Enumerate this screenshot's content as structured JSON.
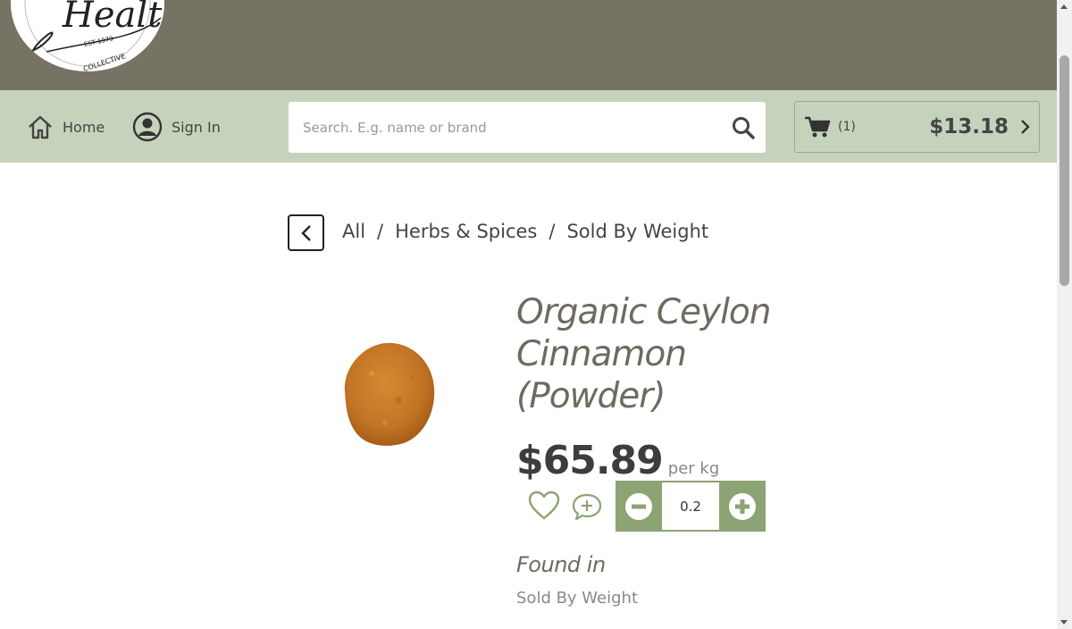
{
  "logo": {
    "script_text": "Health",
    "est_text": "EST 1979",
    "sub_text": "COLLECTIVE"
  },
  "nav": {
    "home_label": "Home",
    "signin_label": "Sign In"
  },
  "search": {
    "placeholder": "Search. E.g. name or brand"
  },
  "cart": {
    "count": "(1)",
    "total": "$13.18"
  },
  "breadcrumb": {
    "items": [
      "All",
      "Herbs & Spices",
      "Sold By Weight"
    ],
    "separator": "/"
  },
  "product": {
    "title": "Organic Ceylon Cinnamon (Powder)",
    "price": "$65.89",
    "unit": "per kg",
    "quantity": "0.2"
  },
  "found_in": {
    "heading": "Found in",
    "category": "Sold By Weight"
  },
  "colors": {
    "banner": "#767365",
    "navbar": "#c6d3bc",
    "qty_accent": "#8ca373",
    "title_text": "#6e6a5f"
  },
  "icons": [
    "home-icon",
    "user-icon",
    "search-icon",
    "cart-icon",
    "chevron-right-icon",
    "chevron-left-icon",
    "heart-icon",
    "comment-plus-icon",
    "minus-icon",
    "plus-icon"
  ]
}
